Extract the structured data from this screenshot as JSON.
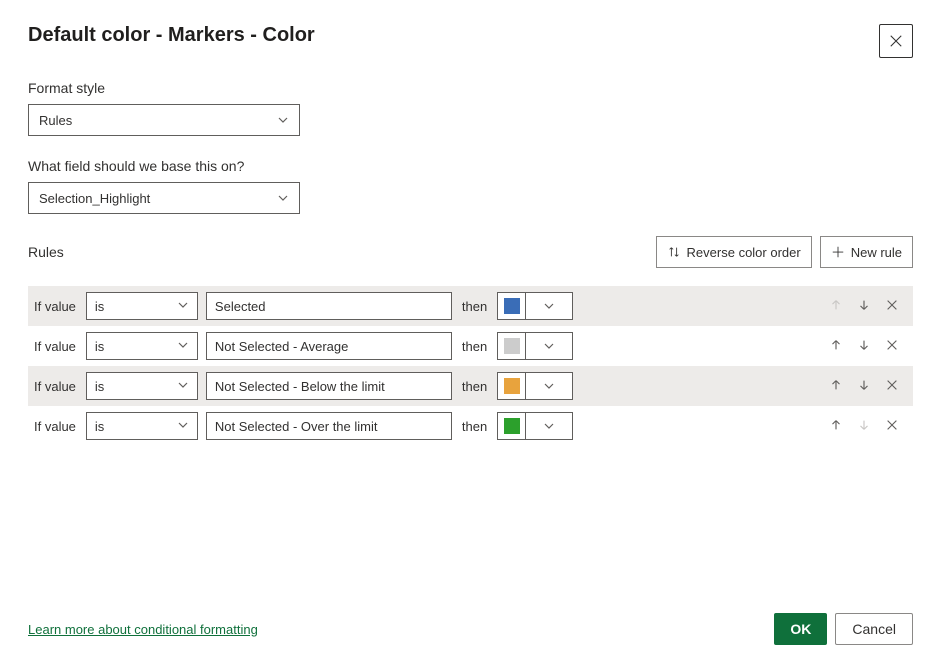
{
  "dialog": {
    "title": "Default color - Markers - Color"
  },
  "formatStyle": {
    "label": "Format style",
    "value": "Rules"
  },
  "baseField": {
    "label": "What field should we base this on?",
    "value": "Selection_Highlight"
  },
  "rulesSection": {
    "label": "Rules",
    "reverseBtn": "Reverse color order",
    "newRuleBtn": "New rule"
  },
  "rules": [
    {
      "ifLabel": "If value",
      "operator": "is",
      "value": "Selected",
      "thenLabel": "then",
      "color": "#3a6db7",
      "upDisabled": true,
      "downDisabled": false
    },
    {
      "ifLabel": "If value",
      "operator": "is",
      "value": "Not Selected - Average",
      "thenLabel": "then",
      "color": "#cccccc",
      "upDisabled": false,
      "downDisabled": false
    },
    {
      "ifLabel": "If value",
      "operator": "is",
      "value": "Not Selected - Below the limit",
      "thenLabel": "then",
      "color": "#e8a33d",
      "upDisabled": false,
      "downDisabled": false
    },
    {
      "ifLabel": "If value",
      "operator": "is",
      "value": "Not Selected - Over the limit",
      "thenLabel": "then",
      "color": "#2ca02c",
      "upDisabled": false,
      "downDisabled": true
    }
  ],
  "footer": {
    "learnMore": "Learn more about conditional formatting",
    "ok": "OK",
    "cancel": "Cancel"
  }
}
